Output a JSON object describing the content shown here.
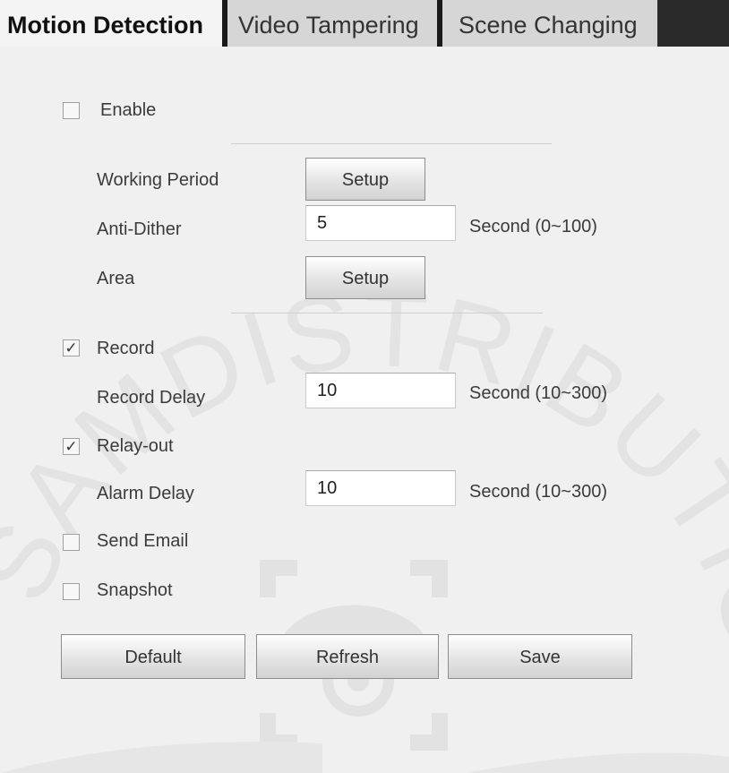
{
  "tabs": [
    "Motion Detection",
    "Video Tampering",
    "Scene Changing"
  ],
  "enable": {
    "label": "Enable",
    "checked": false
  },
  "working_period": {
    "label": "Working Period",
    "button": "Setup"
  },
  "anti_dither": {
    "label": "Anti-Dither",
    "value": "5",
    "unit": "Second (0~100)"
  },
  "area": {
    "label": "Area",
    "button": "Setup"
  },
  "record": {
    "label": "Record",
    "checked": true
  },
  "record_delay": {
    "label": "Record Delay",
    "value": "10",
    "unit": "Second (10~300)"
  },
  "relay_out": {
    "label": "Relay-out",
    "checked": true
  },
  "alarm_delay": {
    "label": "Alarm Delay",
    "value": "10",
    "unit": "Second (10~300)"
  },
  "send_email": {
    "label": "Send Email",
    "checked": false
  },
  "snapshot": {
    "label": "Snapshot",
    "checked": false
  },
  "buttons": {
    "default": "Default",
    "refresh": "Refresh",
    "save": "Save"
  },
  "watermark_text": "SAMDISTRIBUTION",
  "check_glyph": "✓"
}
